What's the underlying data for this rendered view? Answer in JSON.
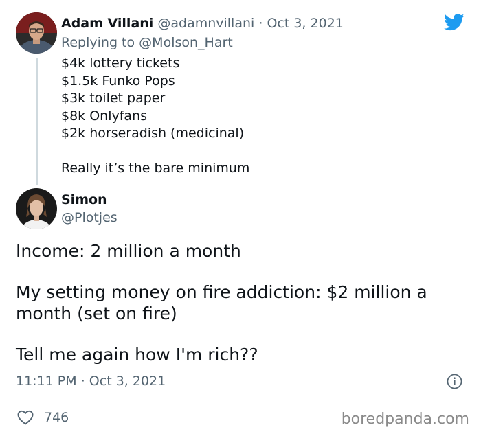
{
  "reply_tweet": {
    "author_name": "Adam Villani",
    "author_handle": "@adamnvillani",
    "separator": "·",
    "date": "Oct 3, 2021",
    "replying_prefix": "Replying to",
    "replying_to": "@Molson_Hart",
    "lines": [
      "$4k lottery tickets",
      "$1.5k Funko Pops",
      "$3k toilet paper",
      "$8k Onlyfans",
      "$2k horseradish (medicinal)",
      "",
      "Really it’s the bare minimum"
    ]
  },
  "main_tweet": {
    "author_name": "Simon",
    "author_handle": "@Plotjes",
    "paragraphs": [
      "Income: 2 million a month",
      "My setting money on fire addiction: $2 million a month (set on fire)",
      "Tell me again how I'm rich??"
    ],
    "time": "11:11 PM",
    "separator": "·",
    "date": "Oct 3, 2021",
    "likes": "746"
  },
  "icons": {
    "brand": "twitter-bird-icon",
    "info": "info-icon",
    "like": "heart-icon"
  },
  "colors": {
    "twitter_blue": "#1d9bf0",
    "text": "#0f1419",
    "muted": "#536471",
    "divider": "#cfd9de",
    "watermark": "#8a8a8a"
  },
  "watermark": "boredpanda.com"
}
